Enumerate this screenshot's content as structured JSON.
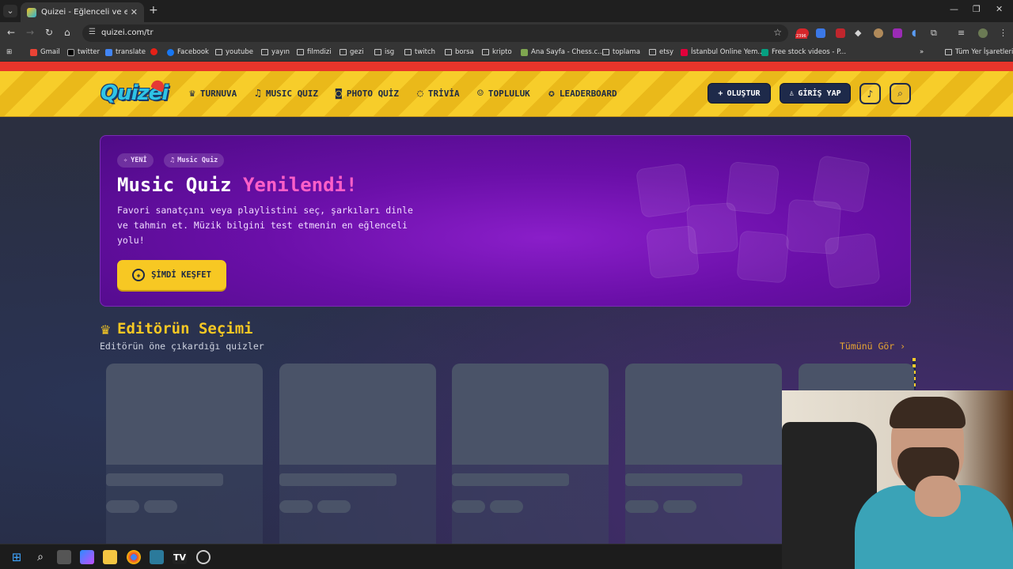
{
  "browser": {
    "tab": {
      "title": "Quizei - Eğlenceli ve etkileşimli"
    },
    "address": {
      "url": "quizei.com/tr"
    },
    "extension_badge": "2396",
    "bookmarks": [
      "Gmail",
      "twitter",
      "translate",
      "Facebook",
      "youtube",
      "yayın",
      "filmdizi",
      "gezi",
      "isg",
      "twitch",
      "borsa",
      "kripto",
      "Ana Sayfa - Chess.c...",
      "toplama",
      "etsy",
      "İstanbul Online Yem...",
      "Free stock videos - P..."
    ],
    "all_bookmarks": "Tüm Yer İşaretleri"
  },
  "site": {
    "logo": "Quizei",
    "nav": [
      "TURNUVA",
      "MUSIC QUIZ",
      "PHOTO QUİZ",
      "TRİVİA",
      "TOPLULUK",
      "LEADERBOARD"
    ],
    "create_label": "OLUŞTUR",
    "login_label": "GİRİŞ YAP"
  },
  "hero": {
    "badge_new": "YENİ",
    "badge_music": "Music Quiz",
    "title_main": "Music Quiz",
    "title_accent": "Yenilendi!",
    "description": "Favori sanatçını veya playlistini seç, şarkıları dinle ve tahmin et. Müzik bilgini test etmenin en eğlenceli yolu!",
    "cta": "ŞİMDİ KEŞFET"
  },
  "editors_pick": {
    "title": "Editörün Seçimi",
    "subtitle": "Editörün öne çıkardığı quizler",
    "see_all": "Tümünü Gör ›"
  },
  "colors": {
    "header_yellow": "#f7cd2a",
    "hero_purple": "#6a0fa8",
    "accent_pink": "#ff5fc8",
    "navy": "#1e2a4a"
  }
}
